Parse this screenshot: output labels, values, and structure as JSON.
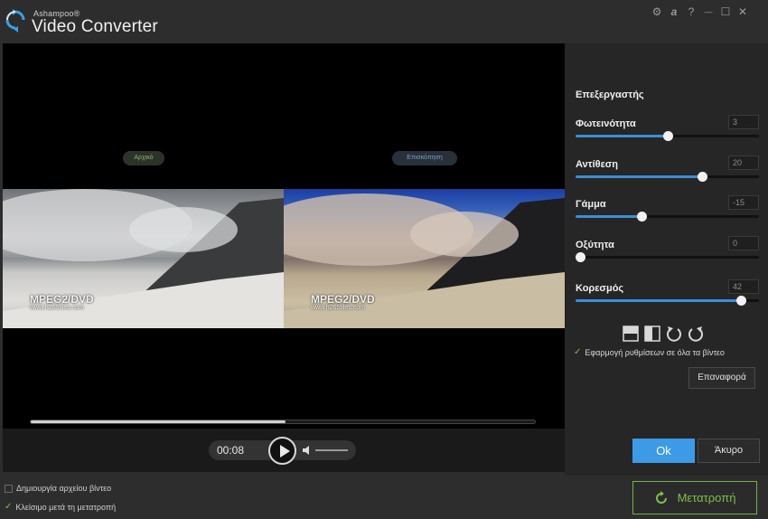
{
  "app": {
    "brand": "Ashampoo®",
    "title": "Video Converter",
    "window_icons": [
      "gear-icon",
      "ashampoo-a-icon",
      "help-icon",
      "minimize-icon",
      "maximize-icon",
      "close-icon"
    ],
    "window_glyphs": [
      "⚙",
      "a",
      "?",
      "—",
      "☐",
      "✕"
    ]
  },
  "viewer": {
    "original_label": "Αρχικό",
    "preview_label": "Επισκόπηση",
    "watermark_title": "MPEG2/DVD",
    "watermark_url": "www.h265files.com",
    "progress": 0.505,
    "time": "00:08",
    "volume": 0.0
  },
  "panel": {
    "title": "Επεξεργαστής",
    "adjustments": [
      {
        "label": "Φωτεινότητα",
        "value": "3",
        "fraction": 0.5
      },
      {
        "label": "Αντίθεση",
        "value": "20",
        "fraction": 0.69
      },
      {
        "label": "Γάμμα",
        "value": "-15",
        "fraction": 0.36
      },
      {
        "label": "Οξύτητα",
        "value": "0",
        "fraction": 0.0
      },
      {
        "label": "Κορεσμός",
        "value": "42",
        "fraction": 0.9
      }
    ],
    "tools": [
      "flip-vertical-icon",
      "flip-horizontal-icon",
      "rotate-left-icon",
      "rotate-right-icon"
    ],
    "apply_all": "Εφαρμογή ρυθμίσεων σε όλα τα βίντεο",
    "reset": "Επαναφορά",
    "ok": "Ok",
    "cancel": "Άκυρο"
  },
  "footer": {
    "create_file": "Δημιουργία αρχείου βίντεο",
    "close_after": "Κλείσιμο μετά τη μετατροπή",
    "convert": "Μετατροπή"
  },
  "colors": {
    "accent": "#3d9ae6",
    "green": "#7cc04a"
  }
}
